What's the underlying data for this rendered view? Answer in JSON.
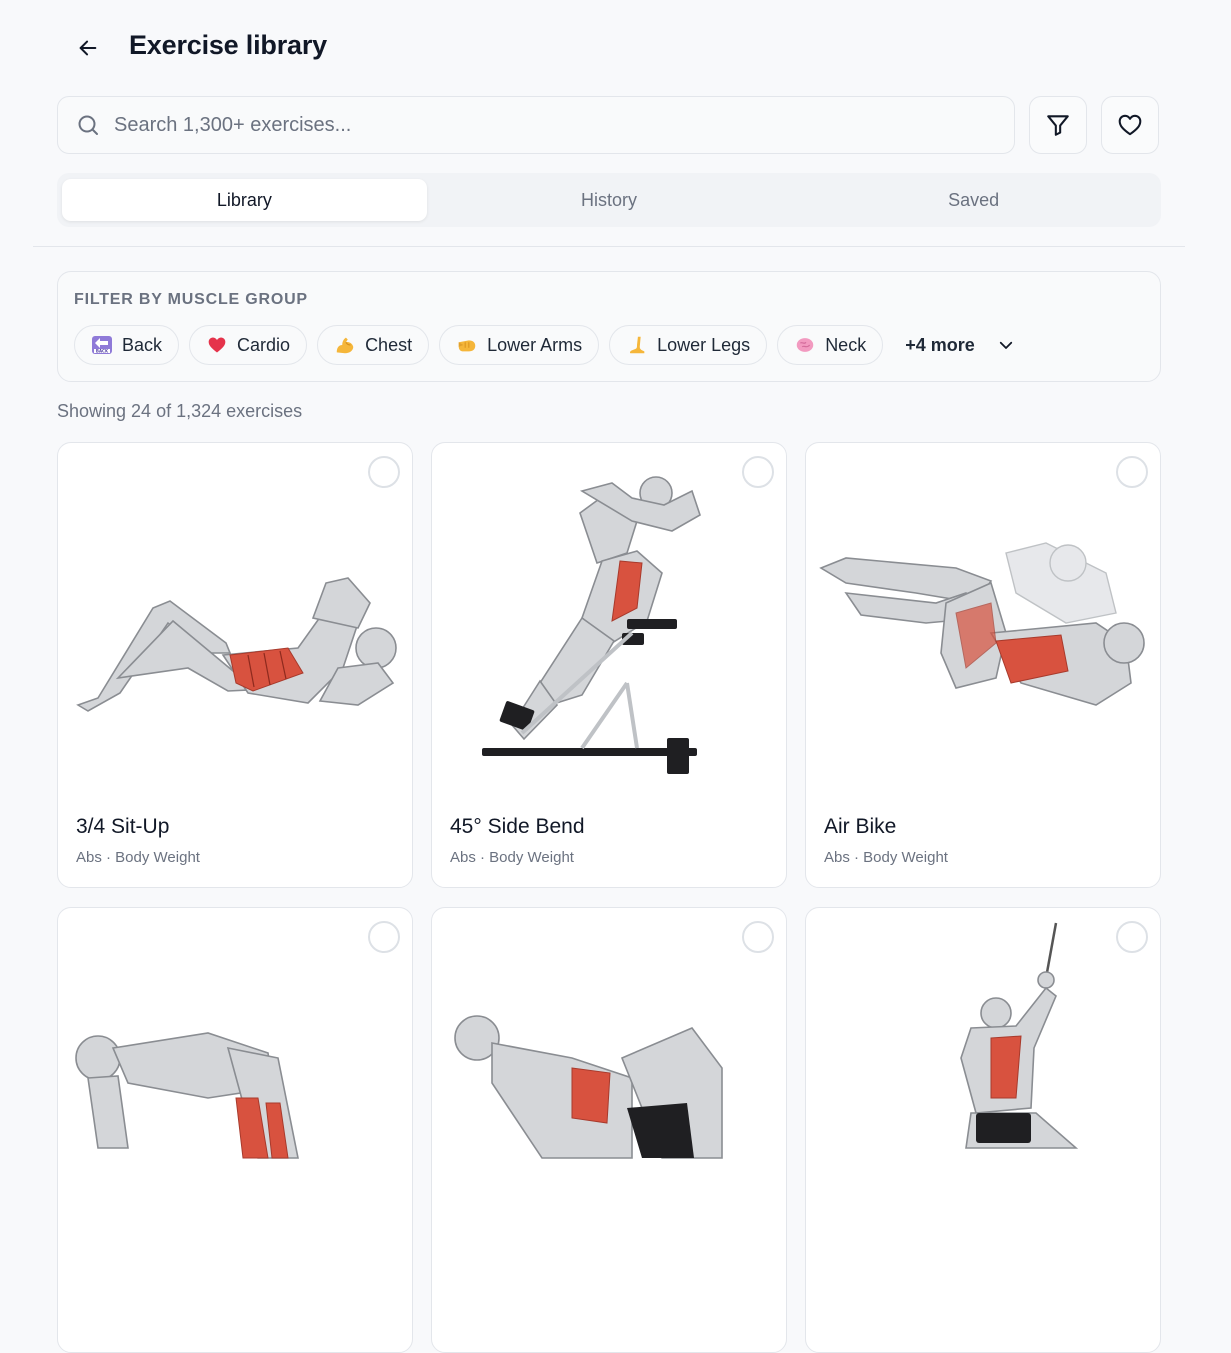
{
  "header": {
    "title": "Exercise library"
  },
  "search": {
    "placeholder": "Search 1,300+ exercises..."
  },
  "tabs": [
    {
      "label": "Library",
      "active": true
    },
    {
      "label": "History",
      "active": false
    },
    {
      "label": "Saved",
      "active": false
    }
  ],
  "filter": {
    "title": "FILTER BY MUSCLE GROUP",
    "chips": [
      {
        "label": "Back",
        "icon": "back-arrow-emoji"
      },
      {
        "label": "Cardio",
        "icon": "heart-emoji"
      },
      {
        "label": "Chest",
        "icon": "flexed-biceps-emoji"
      },
      {
        "label": "Lower Arms",
        "icon": "fist-emoji"
      },
      {
        "label": "Lower Legs",
        "icon": "leg-emoji"
      },
      {
        "label": "Neck",
        "icon": "brain-emoji"
      }
    ],
    "more_label": "+4 more"
  },
  "results": {
    "count_text": "Showing 24 of 1,324 exercises"
  },
  "exercises": [
    {
      "name": "3/4 Sit-Up",
      "meta": "Abs · Body Weight"
    },
    {
      "name": "45° Side Bend",
      "meta": "Abs · Body Weight"
    },
    {
      "name": "Air Bike",
      "meta": "Abs · Body Weight"
    },
    {
      "name": "",
      "meta": ""
    },
    {
      "name": "",
      "meta": ""
    },
    {
      "name": "",
      "meta": ""
    }
  ],
  "colors": {
    "accent_muscle": "#d8523f",
    "text_primary": "#111827",
    "text_muted": "#6b7280",
    "border": "#e3e6eb"
  }
}
